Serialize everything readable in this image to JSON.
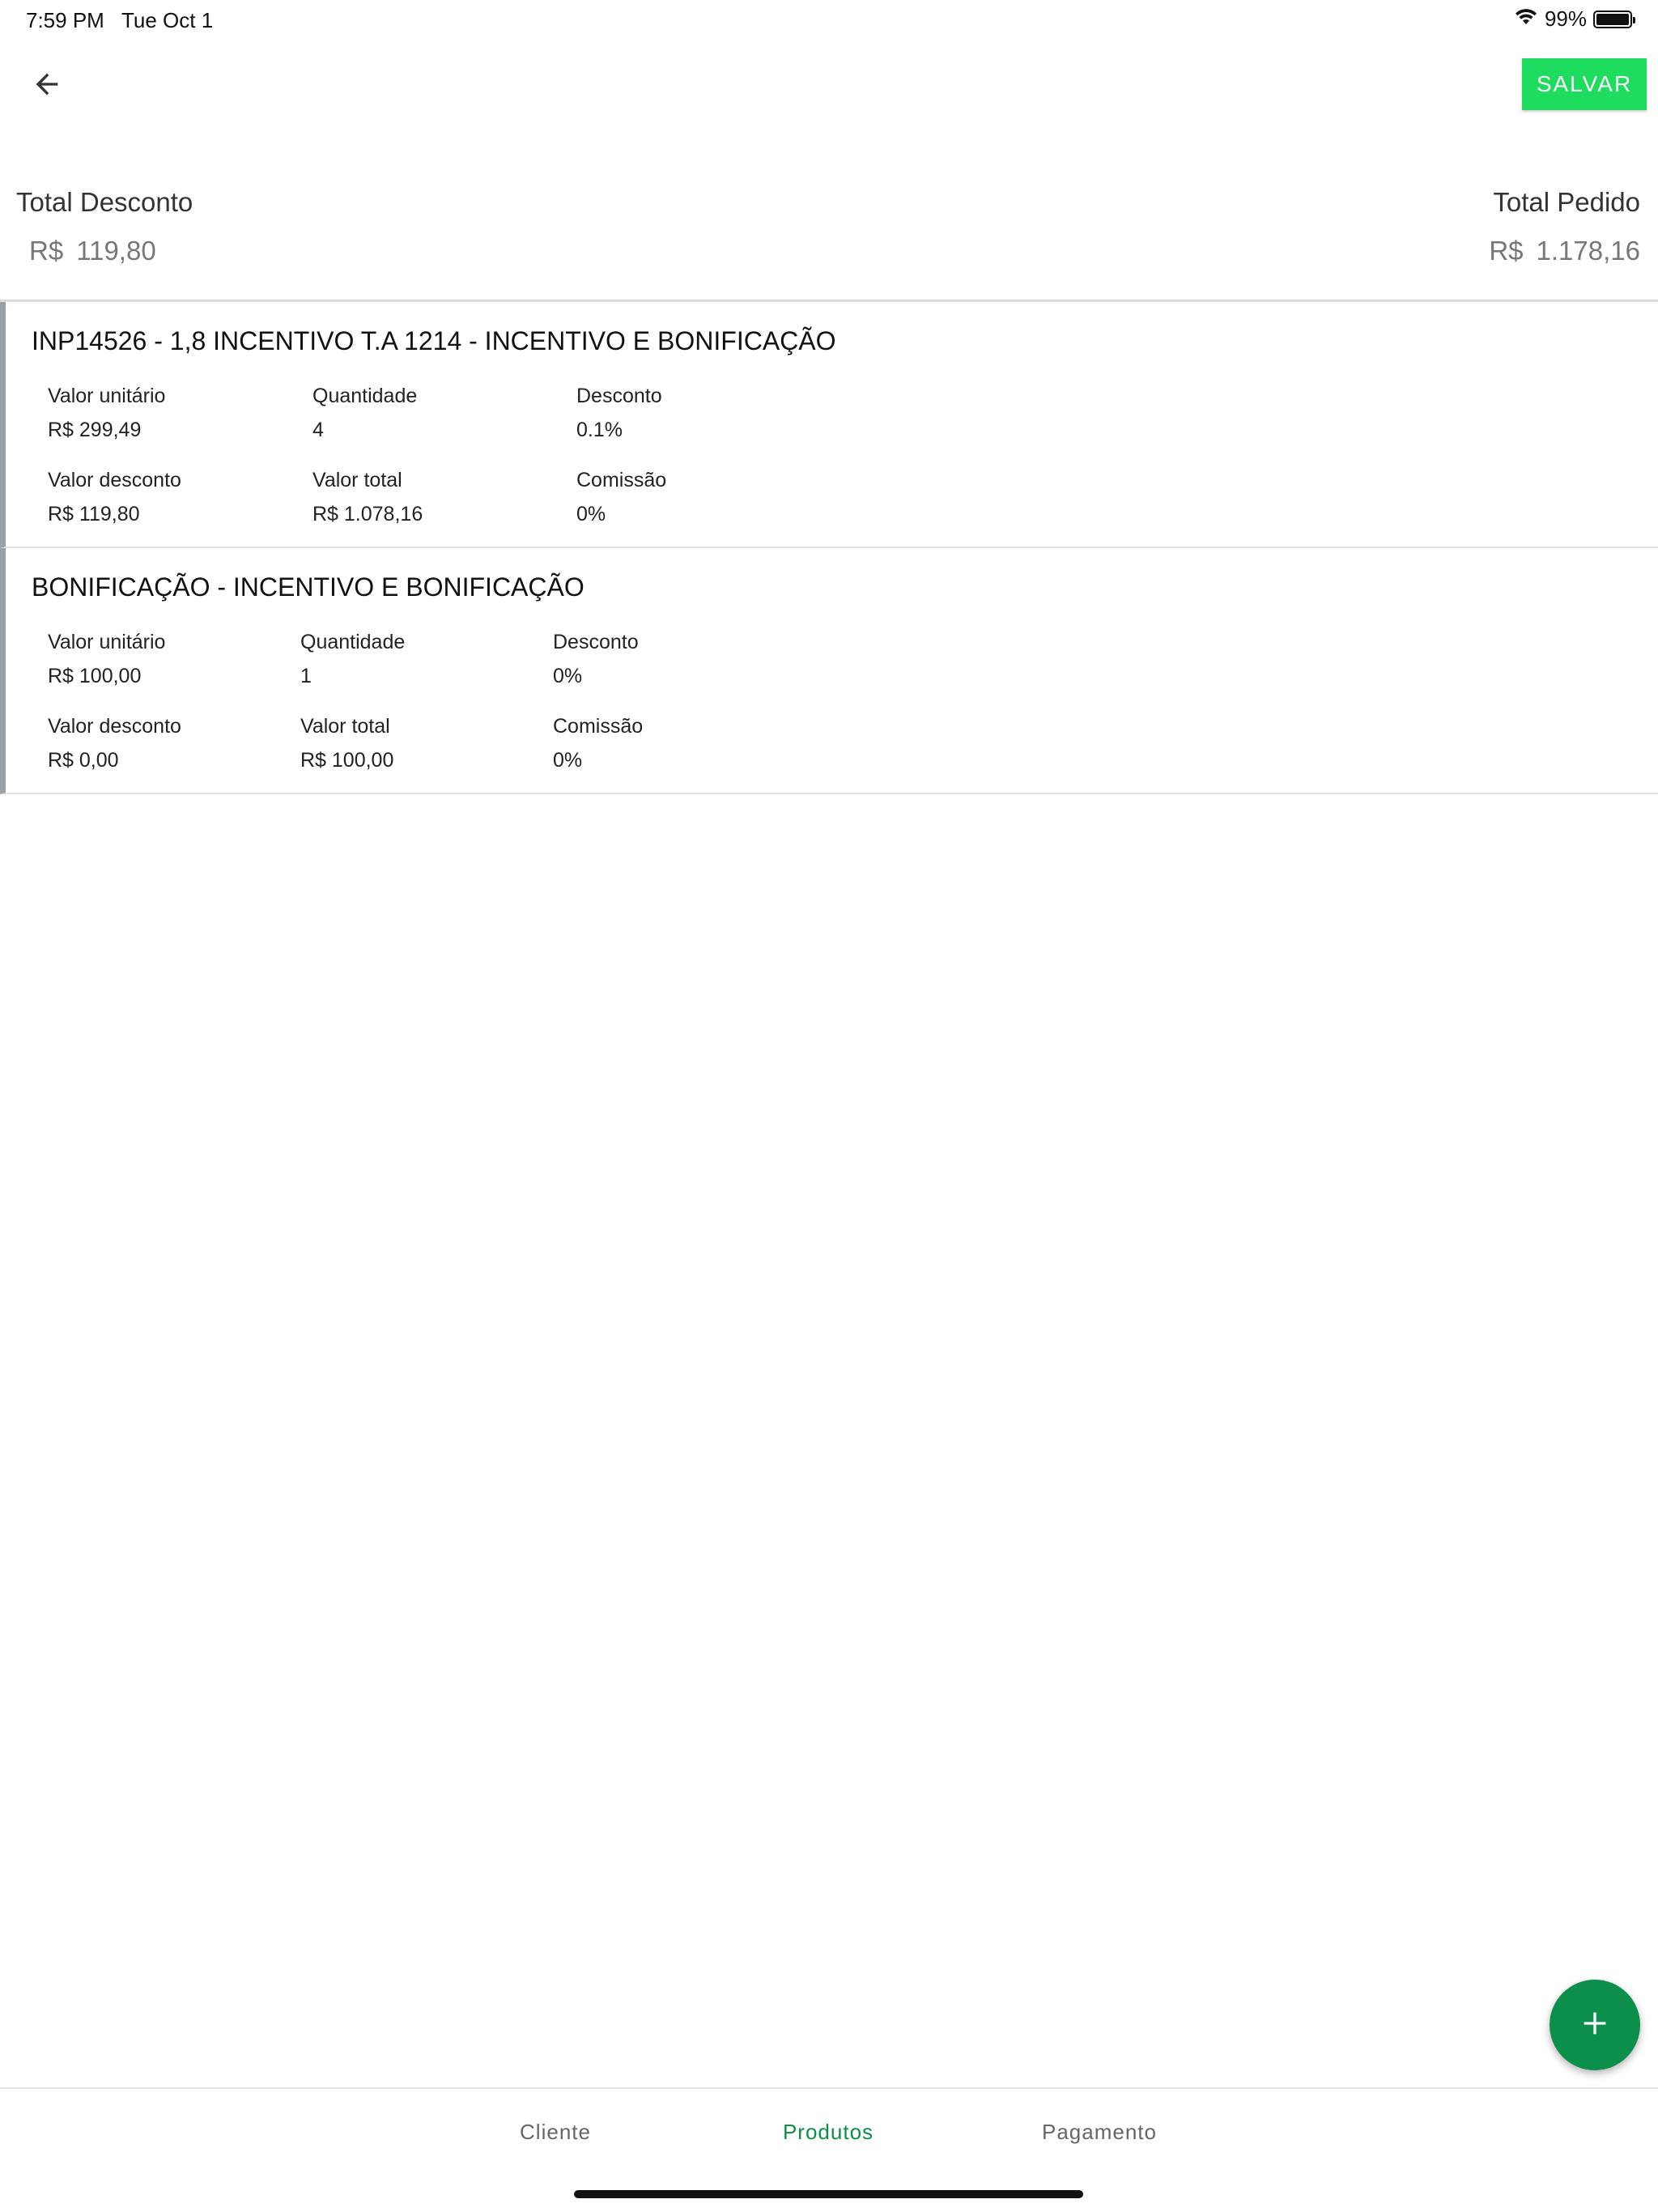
{
  "status_bar": {
    "time": "7:59 PM",
    "date": "Tue Oct 1",
    "battery": "99%",
    "battery_level": 0.99
  },
  "toolbar": {
    "save_label": "SALVAR"
  },
  "totals": {
    "discount_label": "Total Desconto",
    "discount_currency": "R$",
    "discount_value": "119,80",
    "order_label": "Total Pedido",
    "order_currency": "R$",
    "order_value": "1.178,16"
  },
  "products": [
    {
      "title": "INP14526 - 1,8 INCENTIVO T.A 1214 - INCENTIVO E BONIFICAÇÃO",
      "unit_price_label": "Valor unitário",
      "unit_price": "R$  299,49",
      "quantity_label": "Quantidade",
      "quantity": "4",
      "discount_label": "Desconto",
      "discount": "0.1%",
      "discount_value_label": "Valor desconto",
      "discount_value": "R$  119,80",
      "total_label": "Valor total",
      "total": "R$  1.078,16",
      "commission_label": "Comissão",
      "commission": "0%"
    },
    {
      "title": "BONIFICAÇÃO - INCENTIVO E BONIFICAÇÃO",
      "unit_price_label": "Valor unitário",
      "unit_price": "R$  100,00",
      "quantity_label": "Quantidade",
      "quantity": "1",
      "discount_label": "Desconto",
      "discount": "0%",
      "discount_value_label": "Valor desconto",
      "discount_value": "R$  0,00",
      "total_label": "Valor total",
      "total": "R$  100,00",
      "commission_label": "Comissão",
      "commission": "0%"
    }
  ],
  "bottom_nav": {
    "tabs": [
      {
        "label": "Cliente",
        "active": false
      },
      {
        "label": "Produtos",
        "active": true
      },
      {
        "label": "Pagamento",
        "active": false
      }
    ]
  },
  "colors": {
    "accent": "#0b8f4a",
    "save_button": "#1ddc5e",
    "item_border": "#9aa0a8"
  },
  "icons": {
    "back": "arrow-left-icon",
    "fab": "plus-icon",
    "wifi": "wifi-icon",
    "battery": "battery-icon"
  }
}
